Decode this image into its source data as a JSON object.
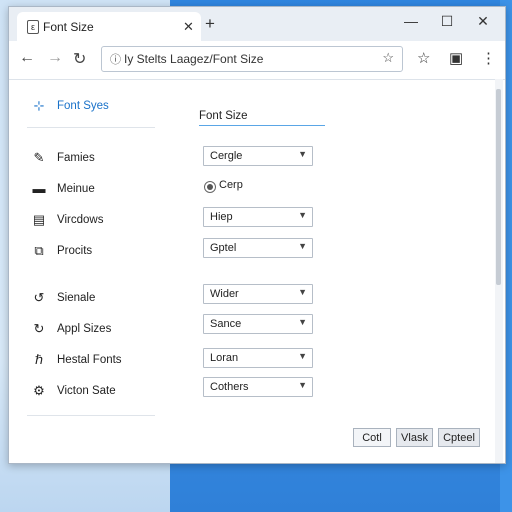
{
  "tab": {
    "title": "Font Size",
    "favicon": "page-icon"
  },
  "address": {
    "text": "Iy Stelts Laagez/Font Size"
  },
  "sidebar": {
    "items": [
      {
        "label": "Font Syes",
        "icon": "pen-nib-icon",
        "active": true
      },
      {
        "label": "Famies",
        "icon": "pencil-icon"
      },
      {
        "label": "Meinue",
        "icon": "menu-icon"
      },
      {
        "label": "Vircdows",
        "icon": "window-icon"
      },
      {
        "label": "Procits",
        "icon": "puzzle-icon"
      },
      {
        "label": "Sienale",
        "icon": "refresh-icon"
      },
      {
        "label": "Appl Sizes",
        "icon": "cycle-icon"
      },
      {
        "label": "Hestal Fonts",
        "icon": "font-icon"
      },
      {
        "label": "Victon Sate",
        "icon": "gear-icon"
      }
    ]
  },
  "content": {
    "title": "Font Size",
    "selects": [
      {
        "value": "Cergle"
      },
      {
        "value": "Hiep"
      },
      {
        "value": "Gptel"
      },
      {
        "value": "Wider"
      },
      {
        "value": "Sance"
      },
      {
        "value": "Loran"
      },
      {
        "value": "Cothers"
      }
    ],
    "radio": {
      "label": "Cerp",
      "checked": true
    }
  },
  "buttons": {
    "first": "Cotl",
    "second": "Vlask",
    "third": "Cpteel"
  },
  "colors": {
    "accent": "#1a72c9",
    "desktop": "#2f86e0"
  }
}
